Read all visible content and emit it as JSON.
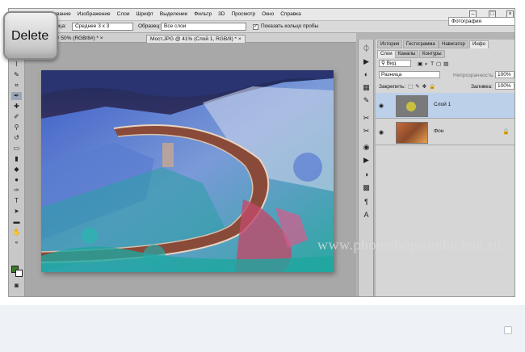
{
  "menu": {
    "items": [
      "ирование",
      "Изображение",
      "Слои",
      "Шрифт",
      "Выделение",
      "Фильтр",
      "3D",
      "Просмотр",
      "Окно",
      "Справка"
    ]
  },
  "options_bar": {
    "sample_label": "бразца:",
    "sample_value": "Среднее 3 х 3",
    "source_label": "Образец:",
    "source_value": "Все слои",
    "ring_label": "Показать кольцо пробы",
    "ring_checked": "✓",
    "workspace": "Фотография"
  },
  "doc_tabs": [
    {
      "label": "ашина.jpg @ 50% (RGB/8#) *",
      "close": "×",
      "active": false
    },
    {
      "label": "Мост.JPG @ 41% (Слой 1, RGB/8) *",
      "close": "×",
      "active": true
    }
  ],
  "panel": {
    "top_tabs": [
      "История",
      "Гистограмма",
      "Навигатор",
      "Инфо"
    ],
    "sub_tabs": [
      "Слои",
      "Каналы",
      "Контуры"
    ],
    "filter_value": "Вид",
    "blend_mode": "Разница",
    "opacity_label": "Непрозрачность:",
    "opacity_value": "100%",
    "lock_label": "Закрепить:",
    "fill_label": "Заливка:",
    "fill_value": "100%",
    "layers": [
      {
        "name": "Слой 1",
        "selected": true
      },
      {
        "name": "Фон",
        "selected": false,
        "locked": true
      }
    ]
  },
  "overlay": {
    "key_label": "Delete",
    "watermark": "www.photoshopsunduchok.ru"
  },
  "icons": {
    "eye": "eye-icon",
    "lock": "lock-icon"
  }
}
